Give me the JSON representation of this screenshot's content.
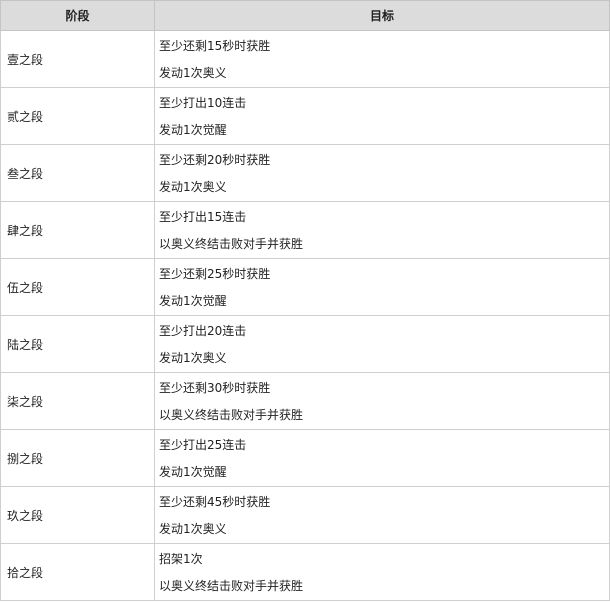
{
  "header": {
    "stage": "阶段",
    "goal": "目标"
  },
  "rows": [
    {
      "stage": "壹之段",
      "goals": [
        "至少还剩15秒时获胜",
        "发动1次奥义"
      ]
    },
    {
      "stage": "贰之段",
      "goals": [
        "至少打出10连击",
        "发动1次觉醒"
      ]
    },
    {
      "stage": "叁之段",
      "goals": [
        "至少还剩20秒时获胜",
        "发动1次奥义"
      ]
    },
    {
      "stage": "肆之段",
      "goals": [
        "至少打出15连击",
        "以奥义终结击败对手并获胜"
      ]
    },
    {
      "stage": "伍之段",
      "goals": [
        "至少还剩25秒时获胜",
        "发动1次觉醒"
      ]
    },
    {
      "stage": "陆之段",
      "goals": [
        "至少打出20连击",
        "发动1次奥义"
      ]
    },
    {
      "stage": "柒之段",
      "goals": [
        "至少还剩30秒时获胜",
        "以奥义终结击败对手并获胜"
      ]
    },
    {
      "stage": "捌之段",
      "goals": [
        "至少打出25连击",
        "发动1次觉醒"
      ]
    },
    {
      "stage": "玖之段",
      "goals": [
        "至少还剩45秒时获胜",
        "发动1次奥义"
      ]
    },
    {
      "stage": "拾之段",
      "goals": [
        "招架1次",
        "以奥义终结击败对手并获胜"
      ]
    }
  ]
}
